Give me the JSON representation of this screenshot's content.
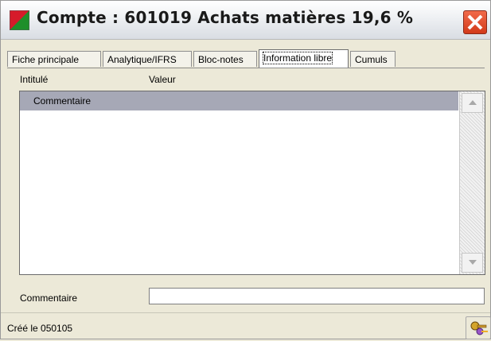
{
  "window": {
    "title": "Compte : 601019 Achats matières 19,6 %"
  },
  "icons": {
    "app": "account-book-icon",
    "close": "close-icon",
    "scroll_up": "arrow-up-icon",
    "scroll_down": "arrow-down-icon",
    "tool": "keys-tool-icon"
  },
  "tabs": [
    {
      "label": "Fiche principale"
    },
    {
      "label": "Analytique/IFRS"
    },
    {
      "label": "Bloc-notes"
    },
    {
      "label": "Information libre",
      "active": true
    },
    {
      "label": "Cumuls"
    }
  ],
  "grid": {
    "columns": [
      "Intitulé",
      "Valeur"
    ],
    "rows": [
      {
        "label": "Commentaire"
      }
    ]
  },
  "field": {
    "label": "Commentaire",
    "value": ""
  },
  "status": {
    "text": "Créé le 050105"
  },
  "colors": {
    "close": "#e0482a",
    "selected_row": "#a6a8b6",
    "window_bg": "#ece9d8"
  }
}
